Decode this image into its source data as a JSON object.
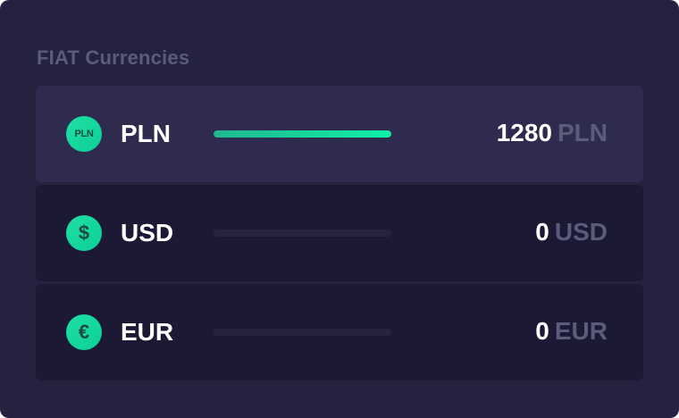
{
  "section": {
    "title": "FIAT Currencies"
  },
  "currencies": [
    {
      "icon_label": "PLN",
      "icon": "pln-coin-icon",
      "code": "PLN",
      "amount": "1280",
      "unit": "PLN",
      "progress": 1.0,
      "selected": true
    },
    {
      "icon_label": "$",
      "icon": "dollar-coin-icon",
      "code": "USD",
      "amount": "0",
      "unit": "USD",
      "progress": 0,
      "selected": false
    },
    {
      "icon_label": "€",
      "icon": "euro-coin-icon",
      "code": "EUR",
      "amount": "0",
      "unit": "EUR",
      "progress": 0,
      "selected": false
    }
  ],
  "colors": {
    "background": "#252240",
    "row": "#1b1934",
    "row_selected": "#2f2b4e",
    "accent": "#10f0a8",
    "muted_text": "#5d5b7a"
  }
}
